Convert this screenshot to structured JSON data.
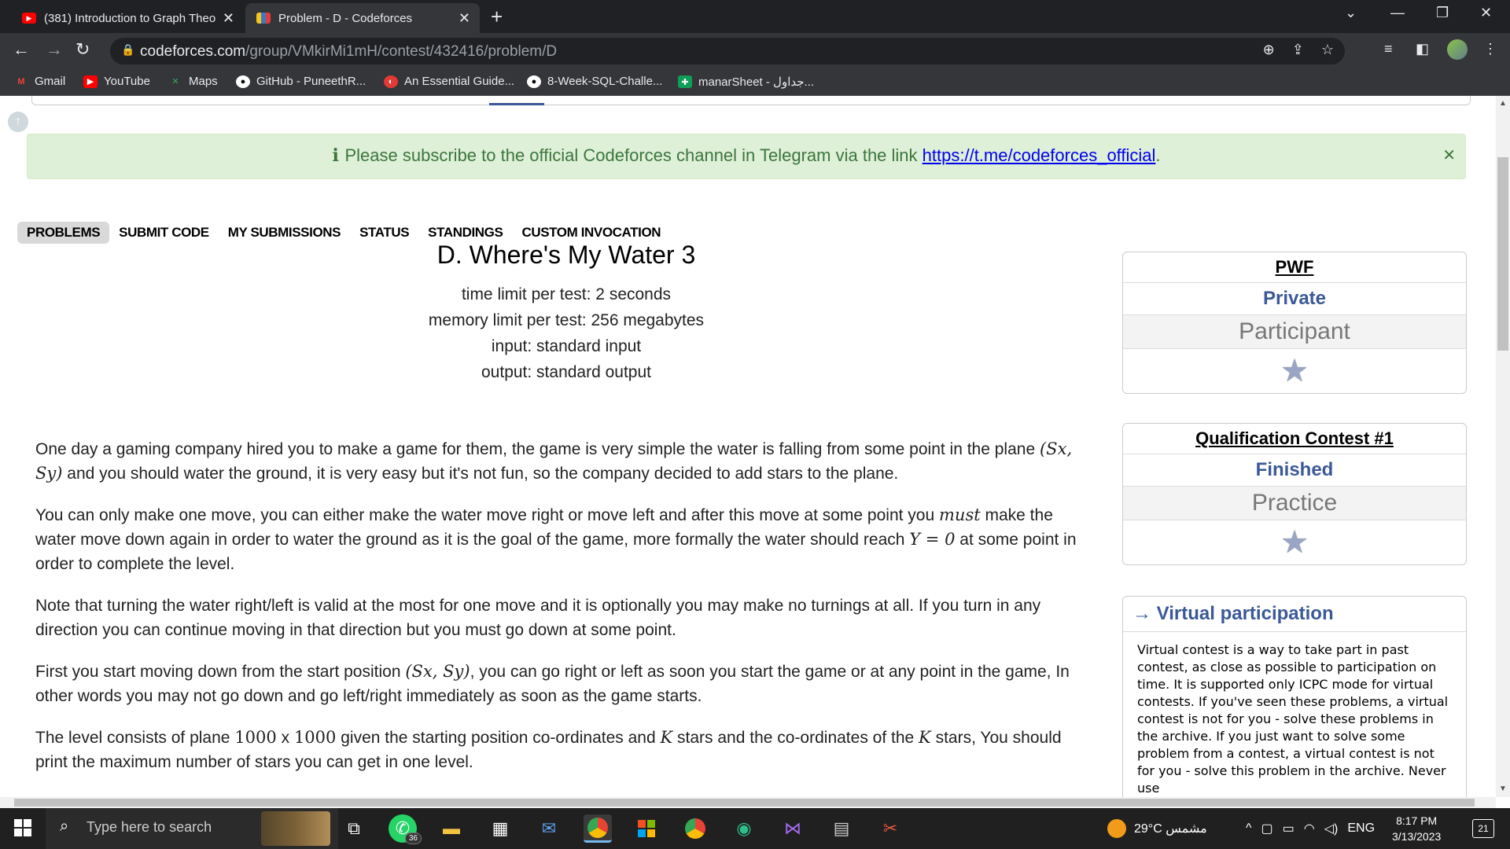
{
  "browser": {
    "tabs": [
      {
        "title": "(381) Introduction to Graph Theo",
        "icon": "youtube-icon",
        "active": false
      },
      {
        "title": "Problem - D - Codeforces",
        "icon": "codeforces-icon",
        "active": true
      }
    ],
    "url_main": "codeforces.com",
    "url_path": "/group/VMkirMi1mH/contest/432416/problem/D",
    "bookmarks": [
      {
        "label": "Gmail",
        "icon": "gmail-icon"
      },
      {
        "label": "YouTube",
        "icon": "youtube-icon"
      },
      {
        "label": "Maps",
        "icon": "maps-icon"
      },
      {
        "label": "GitHub - PuneethR...",
        "icon": "github-icon"
      },
      {
        "label": "An Essential Guide...",
        "icon": "site-icon"
      },
      {
        "label": "8-Week-SQL-Challe...",
        "icon": "github-icon"
      },
      {
        "label": "manarSheet - جداول...",
        "icon": "sheets-icon"
      }
    ]
  },
  "alert": {
    "icon": "info-icon",
    "text": "Please subscribe to the official Codeforces channel in Telegram via the link ",
    "link": "https://t.me/codeforces_official",
    "suffix": "."
  },
  "menu": [
    "PROBLEMS",
    "SUBMIT CODE",
    "MY SUBMISSIONS",
    "STATUS",
    "STANDINGS",
    "CUSTOM INVOCATION"
  ],
  "problem": {
    "title": "D. Where's My Water 3",
    "time_limit": "time limit per test: 2 seconds",
    "memory_limit": "memory limit per test: 256 megabytes",
    "input": "input: standard input",
    "output": "output: standard output",
    "p1_a": "One day a gaming company hired you to make a game for them, the game is very simple the water is falling from some point in the plane ",
    "p1_math": "(Sx, Sy)",
    "p1_b": " and you should water the ground, it is very easy but it's not fun, so the company decided to add stars to the plane.",
    "p2_a": "You can only make one move, you can either make the water move right or move left and after this move at some point you ",
    "p2_must": "must",
    "p2_b": " make the water move down again in order to water the ground as it is the goal of the game, more formally the water should reach ",
    "p2_math": "Y = 0",
    "p2_c": " at some point in order to complete the level.",
    "p3": "Note that turning the water right/left is valid at the most for one move and it is optionally you may make no turnings at all. If you turn in any direction you can continue moving in that direction but you must go down at some point.",
    "p4_a": "First you start moving down from the start position ",
    "p4_math": "(Sx, Sy)",
    "p4_b": ", you can go right or left as soon you start the game or at any point in the game, In other words you may not go down and go left/right immediately as soon as the game starts.",
    "p5_a": "The level consists of plane ",
    "p5_m1": "1000",
    "p5_x": " x ",
    "p5_m2": "1000",
    "p5_b": " given the starting position co-ordinates and ",
    "p5_k1": "K",
    "p5_c": " stars and the co-ordinates of the ",
    "p5_k2": "K",
    "p5_d": " stars, You should print the maximum number of stars you can get in one level."
  },
  "sidebar": {
    "box1": {
      "name": "PWF",
      "visibility": "Private",
      "role": "Participant"
    },
    "box2": {
      "name": "Qualification Contest #1",
      "status": "Finished",
      "phase": "Practice"
    },
    "virtual": {
      "heading": "→ Virtual participation",
      "text": "Virtual contest is a way to take part in past contest, as close as possible to participation on time. It is supported only ICPC mode for virtual contests. If you've seen these problems, a virtual contest is not for you - solve these problems in the archive. If you just want to solve some problem from a contest, a virtual contest is not for you - solve this problem in the archive. Never use"
    }
  },
  "taskbar": {
    "search_placeholder": "Type here to search",
    "whatsapp_badge": "36",
    "weather": "29°C  مشمس",
    "lang": "ENG",
    "time": "8:17 PM",
    "date": "3/13/2023",
    "notifications": "21"
  }
}
